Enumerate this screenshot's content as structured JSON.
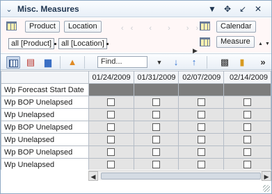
{
  "title": "Misc. Measures",
  "title_icons": [
    "chevron-down-icon",
    "move-icon",
    "minimize-icon",
    "close-icon"
  ],
  "dimensions": {
    "row_buttons": [
      "Product",
      "Location"
    ],
    "row_tags": [
      "all [Product]",
      "all [Location]"
    ],
    "col_buttons": [
      "Calendar",
      "Measure"
    ]
  },
  "toolbar": {
    "find_placeholder": "Find...",
    "more": "»"
  },
  "table": {
    "columns": [
      "01/24/2009",
      "01/31/2009",
      "02/07/2009",
      "02/14/2009"
    ],
    "rows": [
      {
        "label": "Wp Forecast Start Date",
        "type": "date"
      },
      {
        "label": "Wp BOP Unelapsed",
        "type": "checkbox"
      },
      {
        "label": "Wp Unelapsed",
        "type": "checkbox"
      },
      {
        "label": "Wp BOP Unelapsed",
        "type": "checkbox"
      },
      {
        "label": "Wp Unelapsed",
        "type": "checkbox"
      },
      {
        "label": "Wp BOP Unelapsed",
        "type": "checkbox"
      },
      {
        "label": "Wp Unelapsed",
        "type": "checkbox"
      }
    ]
  },
  "colors": {
    "dim_area_bg": "#fff7f7",
    "header_bg": "#f3f5f8",
    "cell_bg": "#e4e4e4",
    "date_cell_bg": "#7d7d7d"
  }
}
